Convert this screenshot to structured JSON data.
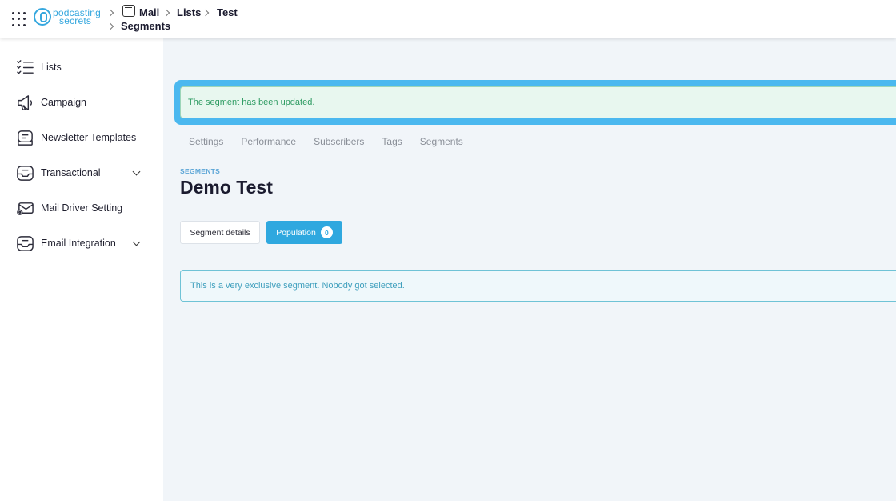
{
  "header": {
    "logo": {
      "line1": "podcasting",
      "line2": "secrets"
    },
    "breadcrumbs": [
      "Mail",
      "Lists",
      "Test",
      "Segments"
    ]
  },
  "sidebar": {
    "items": [
      {
        "label": "Lists",
        "icon": "checklist-icon",
        "expandable": false
      },
      {
        "label": "Campaign",
        "icon": "megaphone-icon",
        "expandable": false
      },
      {
        "label": "Newsletter Templates",
        "icon": "template-icon",
        "expandable": false
      },
      {
        "label": "Transactional",
        "icon": "inbox-icon",
        "expandable": true
      },
      {
        "label": "Mail Driver Setting",
        "icon": "mail-settings-icon",
        "expandable": false
      },
      {
        "label": "Email Integration",
        "icon": "inbox-integration-icon",
        "expandable": true
      }
    ]
  },
  "alert": {
    "message": "The segment has been updated."
  },
  "tabs": [
    "Settings",
    "Performance",
    "Subscribers",
    "Tags",
    "Segments"
  ],
  "page": {
    "overline": "SEGMENTS",
    "title": "Demo Test"
  },
  "buttons": {
    "segment_details": "Segment details",
    "population": "Population",
    "population_count": "0"
  },
  "info": {
    "message": "This is a very exclusive segment. Nobody got selected."
  },
  "colors": {
    "accent": "#2fa8df",
    "alert_border": "#4bb8ef",
    "success_text": "#2e9b62",
    "info_text": "#3f9fbd",
    "main_bg": "#f1f5f9"
  }
}
